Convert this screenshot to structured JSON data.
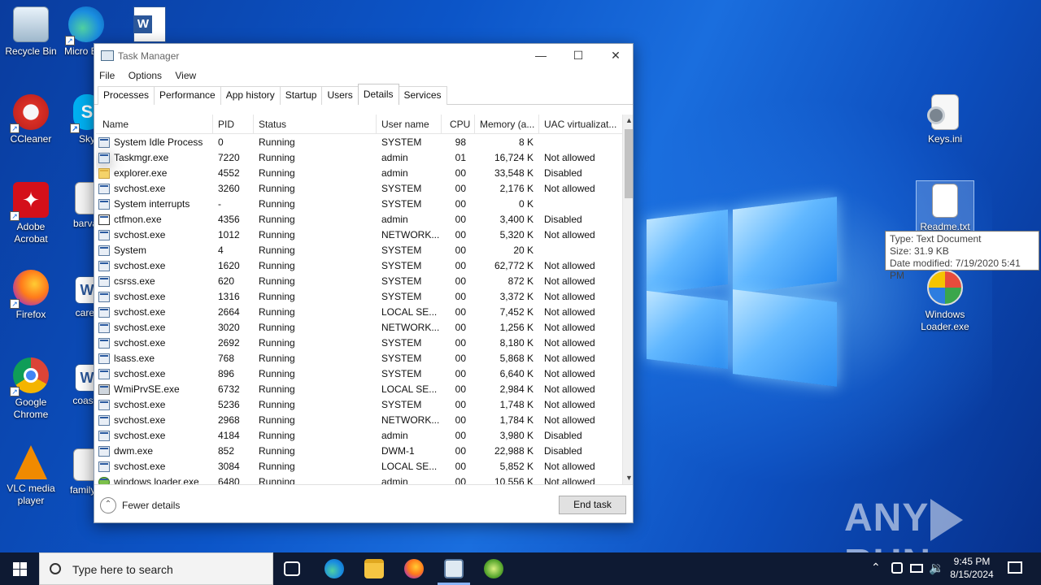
{
  "desktop": {
    "icons": [
      {
        "label": "Recycle Bin",
        "icon": "recycle-bin-icon"
      },
      {
        "label": "Micro Edg",
        "icon": "edge-icon"
      },
      {
        "label": "CCleaner",
        "icon": "ccleaner-icon"
      },
      {
        "label": "Sky",
        "icon": "skype-icon"
      },
      {
        "label": "Adobe Acrobat",
        "icon": "acrobat-icon"
      },
      {
        "label": "barvar",
        "icon": "image-icon"
      },
      {
        "label": "Firefox",
        "icon": "firefox-icon"
      },
      {
        "label": "carell",
        "icon": "word-doc-icon"
      },
      {
        "label": "Google Chrome",
        "icon": "chrome-icon"
      },
      {
        "label": "coastd",
        "icon": "word-doc-icon"
      },
      {
        "label": "VLC media player",
        "icon": "vlc-icon"
      },
      {
        "label": "familyp",
        "icon": "image-icon"
      },
      {
        "label": "Keys.ini",
        "icon": "settings-file-icon"
      },
      {
        "label": "Readme.txt",
        "icon": "text-file-icon"
      },
      {
        "label": "Windows Loader.exe",
        "icon": "windows-loader-icon"
      }
    ]
  },
  "tooltip": {
    "type": "Type: Text Document",
    "size": "Size: 31.9 KB",
    "modified": "Date modified: 7/19/2020 5:41 PM"
  },
  "task_manager": {
    "title": "Task Manager",
    "menu": [
      "File",
      "Options",
      "View"
    ],
    "tabs": [
      "Processes",
      "Performance",
      "App history",
      "Startup",
      "Users",
      "Details",
      "Services"
    ],
    "active_tab": "Details",
    "columns": [
      "Name",
      "PID",
      "Status",
      "User name",
      "CPU",
      "Memory (a...",
      "UAC virtualizat..."
    ],
    "rows": [
      {
        "name": "System Idle Process",
        "pid": "0",
        "status": "Running",
        "user": "SYSTEM",
        "cpu": "98",
        "mem": "8 K",
        "uac": "",
        "icon": "process-icon"
      },
      {
        "name": "Taskmgr.exe",
        "pid": "7220",
        "status": "Running",
        "user": "admin",
        "cpu": "01",
        "mem": "16,724 K",
        "uac": "Not allowed",
        "icon": "taskmgr-icon"
      },
      {
        "name": "explorer.exe",
        "pid": "4552",
        "status": "Running",
        "user": "admin",
        "cpu": "00",
        "mem": "33,548 K",
        "uac": "Disabled",
        "icon": "folder-icon"
      },
      {
        "name": "svchost.exe",
        "pid": "3260",
        "status": "Running",
        "user": "SYSTEM",
        "cpu": "00",
        "mem": "2,176 K",
        "uac": "Not allowed",
        "icon": "process-icon"
      },
      {
        "name": "System interrupts",
        "pid": "-",
        "status": "Running",
        "user": "SYSTEM",
        "cpu": "00",
        "mem": "0 K",
        "uac": "",
        "icon": "process-icon"
      },
      {
        "name": "ctfmon.exe",
        "pid": "4356",
        "status": "Running",
        "user": "admin",
        "cpu": "00",
        "mem": "3,400 K",
        "uac": "Disabled",
        "icon": "pen-icon"
      },
      {
        "name": "svchost.exe",
        "pid": "1012",
        "status": "Running",
        "user": "NETWORK...",
        "cpu": "00",
        "mem": "5,320 K",
        "uac": "Not allowed",
        "icon": "process-icon"
      },
      {
        "name": "System",
        "pid": "4",
        "status": "Running",
        "user": "SYSTEM",
        "cpu": "00",
        "mem": "20 K",
        "uac": "",
        "icon": "process-icon"
      },
      {
        "name": "svchost.exe",
        "pid": "1620",
        "status": "Running",
        "user": "SYSTEM",
        "cpu": "00",
        "mem": "62,772 K",
        "uac": "Not allowed",
        "icon": "process-icon"
      },
      {
        "name": "csrss.exe",
        "pid": "620",
        "status": "Running",
        "user": "SYSTEM",
        "cpu": "00",
        "mem": "872 K",
        "uac": "Not allowed",
        "icon": "process-icon"
      },
      {
        "name": "svchost.exe",
        "pid": "1316",
        "status": "Running",
        "user": "SYSTEM",
        "cpu": "00",
        "mem": "3,372 K",
        "uac": "Not allowed",
        "icon": "process-icon"
      },
      {
        "name": "svchost.exe",
        "pid": "2664",
        "status": "Running",
        "user": "LOCAL SE...",
        "cpu": "00",
        "mem": "7,452 K",
        "uac": "Not allowed",
        "icon": "process-icon"
      },
      {
        "name": "svchost.exe",
        "pid": "3020",
        "status": "Running",
        "user": "NETWORK...",
        "cpu": "00",
        "mem": "1,256 K",
        "uac": "Not allowed",
        "icon": "process-icon"
      },
      {
        "name": "svchost.exe",
        "pid": "2692",
        "status": "Running",
        "user": "SYSTEM",
        "cpu": "00",
        "mem": "8,180 K",
        "uac": "Not allowed",
        "icon": "process-icon"
      },
      {
        "name": "lsass.exe",
        "pid": "768",
        "status": "Running",
        "user": "SYSTEM",
        "cpu": "00",
        "mem": "5,868 K",
        "uac": "Not allowed",
        "icon": "process-icon"
      },
      {
        "name": "svchost.exe",
        "pid": "896",
        "status": "Running",
        "user": "SYSTEM",
        "cpu": "00",
        "mem": "6,640 K",
        "uac": "Not allowed",
        "icon": "process-icon"
      },
      {
        "name": "WmiPrvSE.exe",
        "pid": "6732",
        "status": "Running",
        "user": "LOCAL SE...",
        "cpu": "00",
        "mem": "2,984 K",
        "uac": "Not allowed",
        "icon": "gear-icon"
      },
      {
        "name": "svchost.exe",
        "pid": "5236",
        "status": "Running",
        "user": "SYSTEM",
        "cpu": "00",
        "mem": "1,748 K",
        "uac": "Not allowed",
        "icon": "process-icon"
      },
      {
        "name": "svchost.exe",
        "pid": "2968",
        "status": "Running",
        "user": "NETWORK...",
        "cpu": "00",
        "mem": "1,784 K",
        "uac": "Not allowed",
        "icon": "process-icon"
      },
      {
        "name": "svchost.exe",
        "pid": "4184",
        "status": "Running",
        "user": "admin",
        "cpu": "00",
        "mem": "3,980 K",
        "uac": "Disabled",
        "icon": "process-icon"
      },
      {
        "name": "dwm.exe",
        "pid": "852",
        "status": "Running",
        "user": "DWM-1",
        "cpu": "00",
        "mem": "22,988 K",
        "uac": "Disabled",
        "icon": "process-icon"
      },
      {
        "name": "svchost.exe",
        "pid": "3084",
        "status": "Running",
        "user": "LOCAL SE...",
        "cpu": "00",
        "mem": "5,852 K",
        "uac": "Not allowed",
        "icon": "process-icon"
      },
      {
        "name": "windows loader.exe",
        "pid": "6480",
        "status": "Running",
        "user": "admin",
        "cpu": "00",
        "mem": "10,556 K",
        "uac": "Not allowed",
        "icon": "windows-loader-icon"
      }
    ],
    "fewer_details": "Fewer details",
    "end_task": "End task"
  },
  "watermark": {
    "left": "ANY",
    "right": "RUN"
  },
  "taskbar": {
    "search_placeholder": "Type here to search",
    "time": "9:45 PM",
    "date": "8/15/2024"
  }
}
